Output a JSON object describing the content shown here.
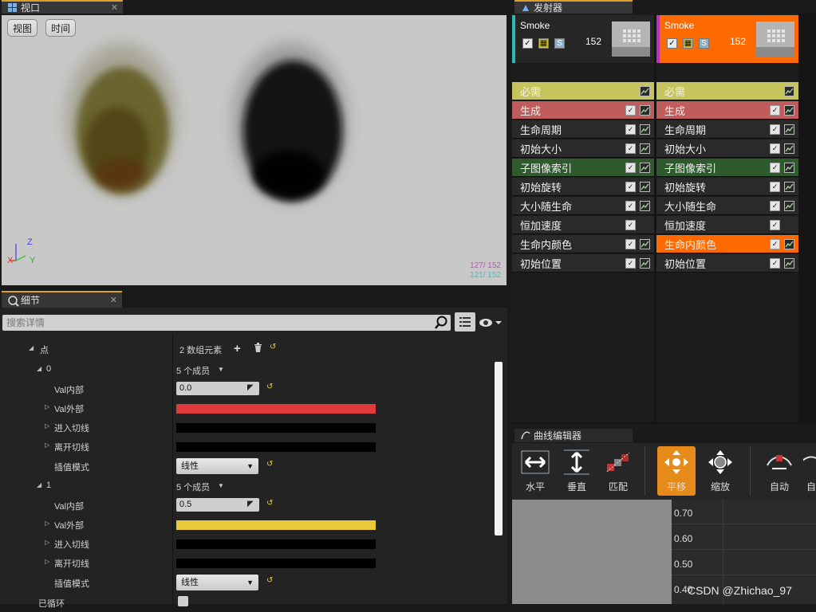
{
  "viewport": {
    "tab_title": "视口",
    "buttons": [
      "视图",
      "时间"
    ],
    "axis_z": "Z",
    "axis_x": "X",
    "axis_y": "Y",
    "counter1": "127/ 152",
    "counter2": "121/ 152",
    "counter1_color": "#c050c0",
    "counter2_color": "#40c0c0"
  },
  "emitters": {
    "tab_title": "发射器",
    "columns": [
      {
        "name": "Smoke",
        "count": "152",
        "accent": "#2fb8b8",
        "modules": [
          {
            "label": "必需",
            "bg": "#c6c45c",
            "text": "#ffffff"
          },
          {
            "label": "生成",
            "bg": "#c05c5c"
          },
          {
            "label": "生命周期",
            "bg": "#2a2a2a"
          },
          {
            "label": "初始大小",
            "bg": "#2a2a2a"
          },
          {
            "label": "子图像索引",
            "bg": "#2e5a2e"
          },
          {
            "label": "初始旋转",
            "bg": "#2a2a2a"
          },
          {
            "label": "大小随生命",
            "bg": "#2a2a2a"
          },
          {
            "label": "恒加速度",
            "bg": "#2a2a2a"
          },
          {
            "label": "生命内颜色",
            "bg": "#2a2a2a"
          },
          {
            "label": "初始位置",
            "bg": "#2a2a2a"
          }
        ]
      },
      {
        "name": "Smoke",
        "count": "152",
        "accent": "#ff6a00",
        "modules": [
          {
            "label": "必需",
            "bg": "#c6c45c"
          },
          {
            "label": "生成",
            "bg": "#c05c5c"
          },
          {
            "label": "生命周期",
            "bg": "#2a2a2a"
          },
          {
            "label": "初始大小",
            "bg": "#2a2a2a"
          },
          {
            "label": "子图像索引",
            "bg": "#2e5a2e"
          },
          {
            "label": "初始旋转",
            "bg": "#2a2a2a"
          },
          {
            "label": "大小随生命",
            "bg": "#2a2a2a"
          },
          {
            "label": "恒加速度",
            "bg": "#2a2a2a"
          },
          {
            "label": "生命内颜色",
            "bg": "#ff6a00"
          },
          {
            "label": "初始位置",
            "bg": "#2a2a2a"
          }
        ]
      }
    ]
  },
  "curve_editor": {
    "tab_title": "曲线编辑器",
    "tools": [
      "水平",
      "垂直",
      "匹配",
      "平移",
      "缩放",
      "自动",
      "自"
    ],
    "active_tool": "平移",
    "y_labels": [
      "0.70",
      "0.60",
      "0.50",
      "0.40"
    ],
    "watermark": "CSDN @Zhichao_97"
  },
  "details": {
    "tab_title": "细节",
    "search_placeholder": "搜索详情",
    "points_label": "点",
    "points_value": "2 数组元素",
    "point0_index": "0",
    "point0_members": "5 个成员",
    "point0_inval_label": "Val内部",
    "point0_inval": "0.0",
    "point0_outval_label": "Val外部",
    "point0_outval_color": "#e03a3a",
    "point0_arrive_label": "进入切线",
    "point0_leave_label": "离开切线",
    "point0_interp_label": "插值模式",
    "point0_interp": "线性",
    "point1_index": "1",
    "point1_members": "5 个成员",
    "point1_inval_label": "Val内部",
    "point1_inval": "0.5",
    "point1_outval_label": "Val外部",
    "point1_outval_color": "#e8c93a",
    "point1_arrive_label": "进入切线",
    "point1_leave_label": "离开切线",
    "point1_interp_label": "插值模式",
    "point1_interp": "线性",
    "looped_label": "已循环"
  }
}
